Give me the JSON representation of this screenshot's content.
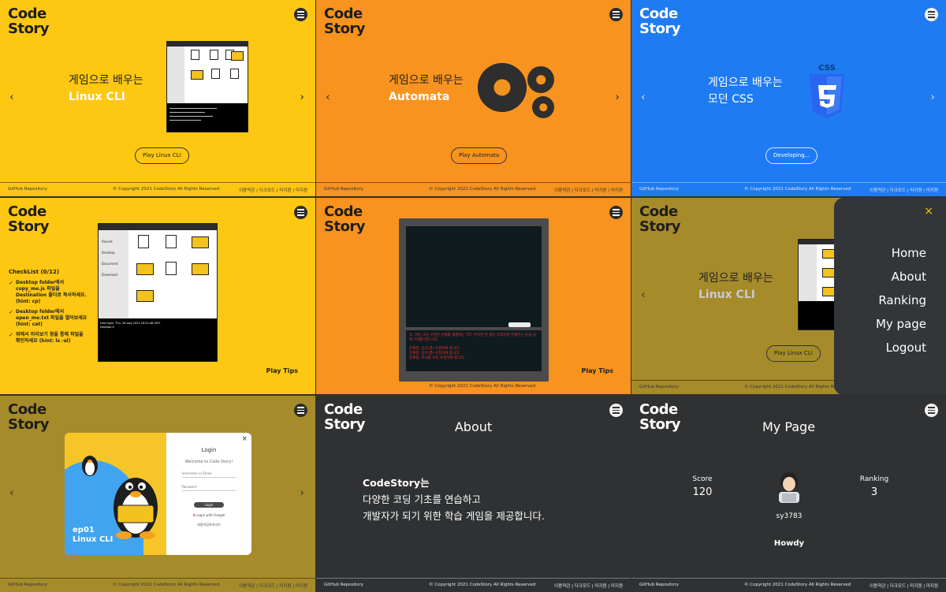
{
  "brand": {
    "line1": "Code",
    "line2": "Story"
  },
  "footer": {
    "github": "GitHub Repository",
    "copyright": "© Copyright 2021 CodeStory All Rights Reserved",
    "links": "이용약관 | 다크모드 | 미지원 | 미지원"
  },
  "nav": {
    "prev": "‹",
    "next": "›"
  },
  "panels": {
    "linux": {
      "line1": "게임으로 배우는",
      "line2": "Linux CLI",
      "button": "Play Linux CLI"
    },
    "automata": {
      "line1": "게임으로 배우는",
      "line2": "Automata",
      "button": "Play Automata"
    },
    "css": {
      "line1": "게임으로 배우는",
      "line2": "모던 CSS",
      "button": "Developing...",
      "badge": "CSS"
    },
    "tips": {
      "play_tips": "Play Tips",
      "checklist_title": "CheckList (0/12)",
      "checklist": [
        "Desktop folder에서 copy_me.js 파일을 Destination 폴더로 복사하세요. (hint: cp)",
        "Desktop folder에서 open_me.txt 파일을 열어보세요 (hint: cat)",
        "위에서 미리보기 창을 통해 파일을 확인하세요 (hint: ls -al)"
      ],
      "terminal_line": "Last login: Thu, 26 Aug 2021 16:24:48 GMT",
      "terminal_prompt": "Desktop $",
      "sidebar": [
        "Recent",
        "Desktop",
        "Document",
        "Download"
      ]
    },
    "game": {
      "message": "오, 이런 그런 구현한 문제를 해결하는 코드 주어진 한 개인 목적지를 전해주는 문을 설계 기계를 만드시오.",
      "errors": [
        "문제점: 상호(결) 수명하여 합니다.",
        "문제점: 상호(결) 수정하여 합니다.",
        "문제점: 조사를 수정 수정하여 합니다."
      ],
      "play_tips": "Play Tips"
    },
    "menu": {
      "line1": "게임으로 배우는",
      "line2": "Linux CLI",
      "button": "Play Linux CLI",
      "close": "×",
      "items": [
        "Home",
        "About",
        "Ranking",
        "My page",
        "Logout"
      ]
    },
    "login": {
      "title": "Login",
      "welcome": "Welcome to Code Story!",
      "username_placeholder": "Username or Email",
      "password_placeholder": "Password",
      "login_button": "Login",
      "google": "Login with Google",
      "register": "회원가입하러가기",
      "episode": "ep01",
      "episode_title": "Linux CLI",
      "close": "×"
    },
    "about": {
      "title": "About",
      "line1": "CodeStory는",
      "line2": "다양한 코딩 기초를 연습하고",
      "line3": "개발자가 되기 위한 학습 게임을 제공합니다."
    },
    "mypage": {
      "title": "My Page",
      "score_label": "Score",
      "score": "120",
      "ranking_label": "Ranking",
      "ranking": "3",
      "username": "sy3783",
      "greeting": "Howdy"
    }
  },
  "colors": {
    "yellow": "#fdc712",
    "orange": "#f7931e",
    "blue": "#1e7bf2",
    "olive": "#a68b2a",
    "dark": "#2f3133"
  }
}
